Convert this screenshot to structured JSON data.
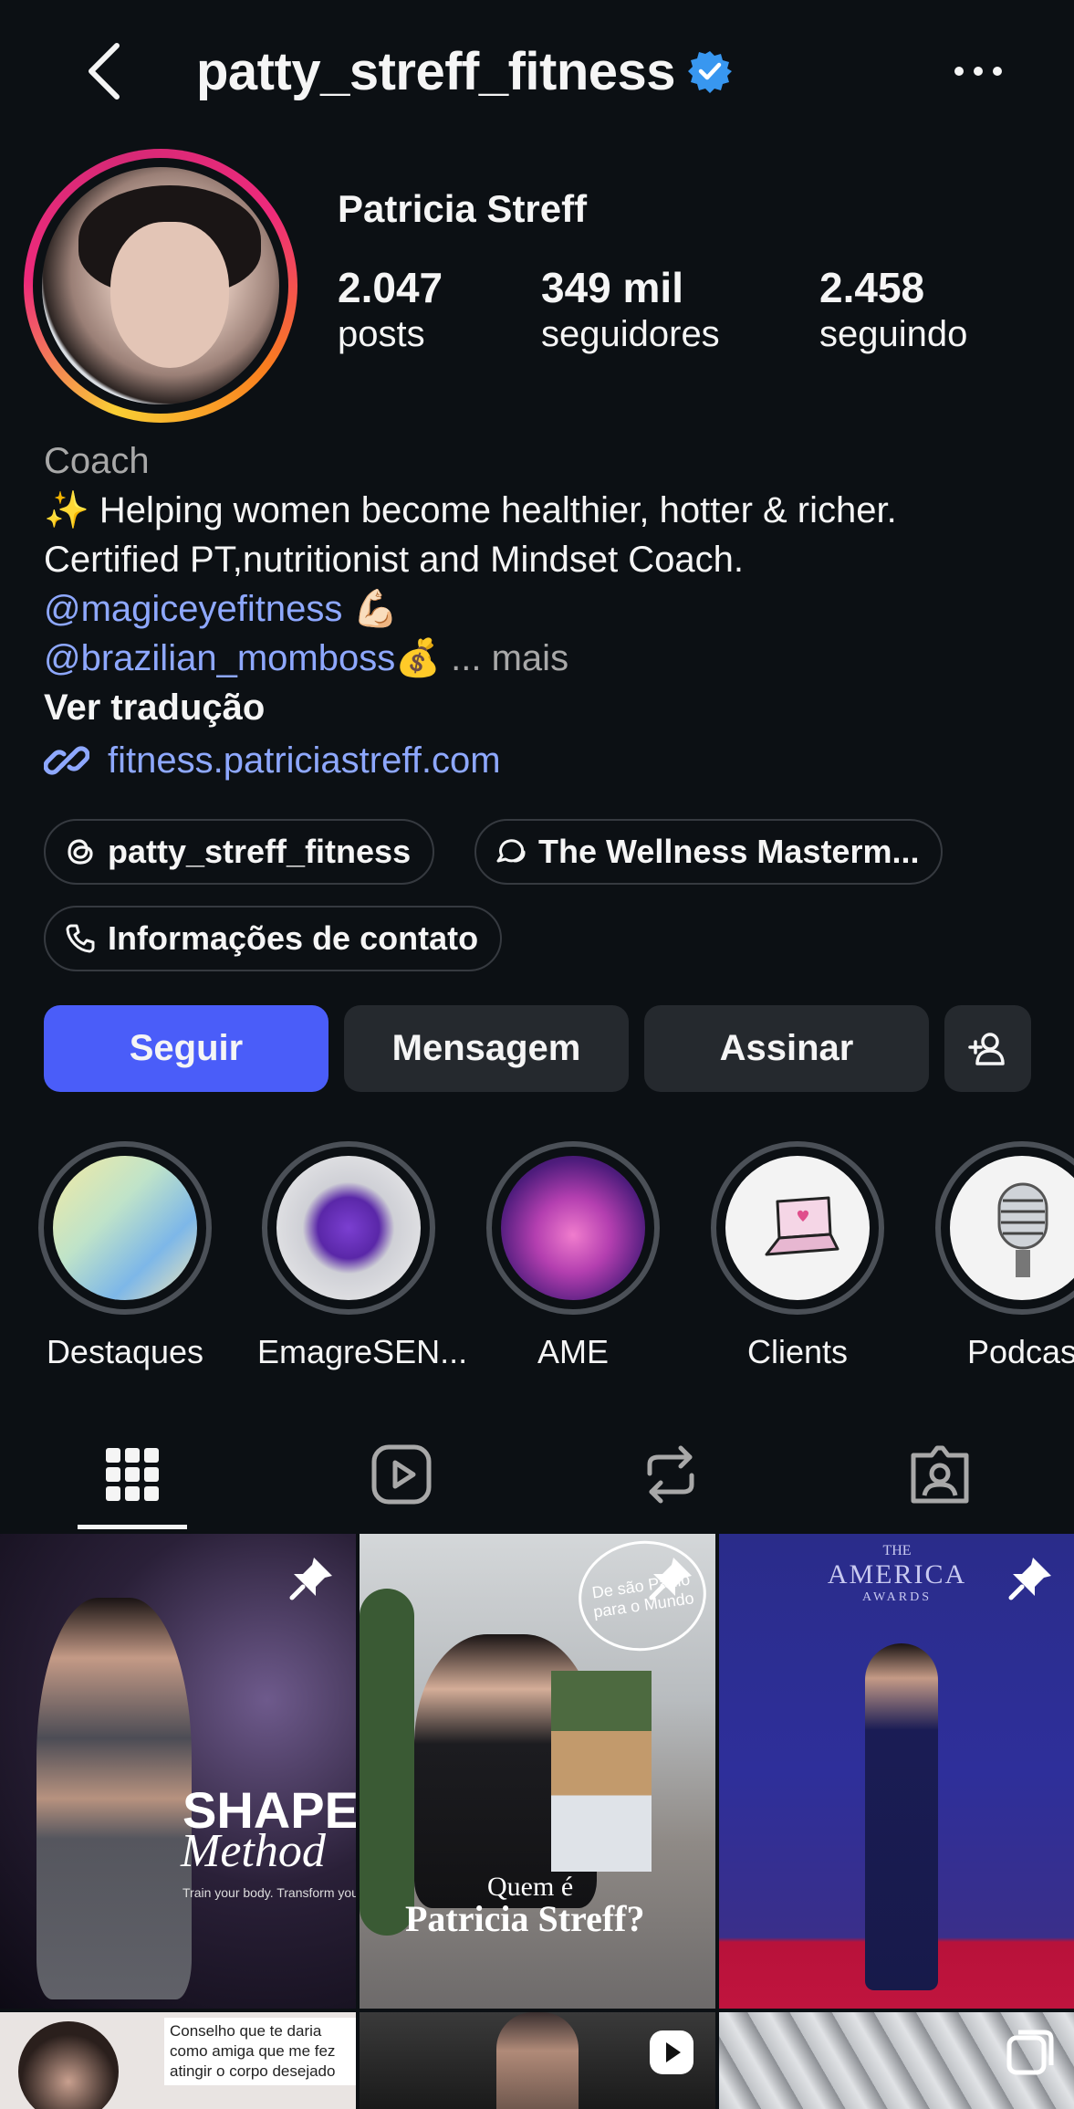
{
  "header": {
    "username": "patty_streff_fitness",
    "back_icon": "chevron-left-icon",
    "verified_icon": "verified-badge-icon",
    "more_icon": "more-horizontal-icon"
  },
  "profile": {
    "full_name": "Patricia Streff",
    "stats": [
      {
        "value": "2.047",
        "label": "posts"
      },
      {
        "value": "349 mil",
        "label": "seguidores"
      },
      {
        "value": "2.458",
        "label": "seguindo"
      }
    ],
    "category": "Coach",
    "bio_line1": "✨ Helping women become healthier, hotter & richer.",
    "bio_line2": "Certified PT,nutritionist and Mindset Coach.",
    "mention1": "@magiceyefitness",
    "mention1_emoji": "💪🏻",
    "mention2": "@brazilian_momboss",
    "mention2_emoji": "💰",
    "more_ellipsis": "...",
    "more_label": "mais",
    "translate": "Ver tradução",
    "website": "fitness.patriciastreff.com"
  },
  "chips": [
    {
      "label": "patty_streff_fitness",
      "icon": "threads-icon"
    },
    {
      "label": "The Wellness Masterm...",
      "icon": "chat-bubbles-icon"
    },
    {
      "label": "Informações de contato",
      "icon": "phone-icon"
    }
  ],
  "actions": {
    "follow": "Seguir",
    "message": "Mensagem",
    "subscribe": "Assinar",
    "suggest_icon": "add-person-icon"
  },
  "highlights": [
    {
      "label": "Destaques"
    },
    {
      "label": "EmagreSEN..."
    },
    {
      "label": "AME"
    },
    {
      "label": "Clients"
    },
    {
      "label": "Podcas"
    }
  ],
  "tabs": [
    {
      "name": "grid-icon",
      "active": true
    },
    {
      "name": "reels-icon",
      "active": false
    },
    {
      "name": "reposts-icon",
      "active": false
    },
    {
      "name": "tagged-icon",
      "active": false
    }
  ],
  "posts": {
    "p1_title": "SHAPE",
    "p1_subtitle": "Method",
    "p1_tagline": "Train your body. Transform your life.",
    "p2_badge_line1": "De são Paulo",
    "p2_badge_line2": "para o Mundo",
    "p2_title1": "Quem é",
    "p2_title2": "Patricia Streff?",
    "p3_title1": "THE",
    "p3_title2": "AMERICA",
    "p3_title3": "AWARDS",
    "p4_text1": "Conselho que te daria",
    "p4_text2": "como amiga que me fez",
    "p4_text3": "atingir o corpo desejado"
  },
  "colors": {
    "background": "#0c1014",
    "accent": "#4a5df9",
    "link": "#8ea8ff",
    "button": "#25292e"
  }
}
